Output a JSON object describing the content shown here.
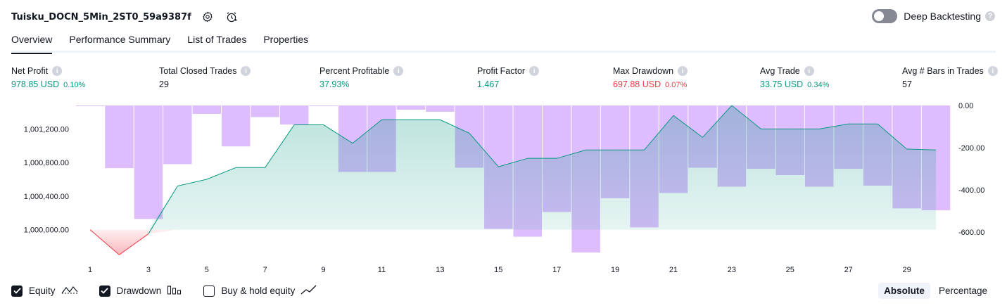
{
  "header": {
    "strategy_name": "Tuisku_DOCN_5Min_2ST0_59a9387f",
    "settings_icon": "gear-icon",
    "alert_icon": "alarm-clock-icon",
    "deep_backtesting_label": "Deep Backtesting",
    "deep_backtesting_enabled": false,
    "help_mark": "?"
  },
  "tabs": [
    {
      "label": "Overview",
      "active": true
    },
    {
      "label": "Performance Summary",
      "active": false
    },
    {
      "label": "List of Trades",
      "active": false
    },
    {
      "label": "Properties",
      "active": false
    }
  ],
  "metrics": [
    {
      "label": "Net Profit",
      "value": "978.85 USD",
      "pct": "0.10%",
      "color": "#089981"
    },
    {
      "label": "Total Closed Trades",
      "value": "29",
      "pct": "",
      "color": "#131722"
    },
    {
      "label": "Percent Profitable",
      "value": "37.93%",
      "pct": "",
      "color": "#089981"
    },
    {
      "label": "Profit Factor",
      "value": "1.467",
      "pct": "",
      "color": "#089981"
    },
    {
      "label": "Max Drawdown",
      "value": "697.88 USD",
      "pct": "0.07%",
      "color": "#f23645"
    },
    {
      "label": "Avg Trade",
      "value": "33.75 USD",
      "pct": "0.34%",
      "color": "#089981"
    },
    {
      "label": "Avg # Bars in Trades",
      "value": "57",
      "pct": "",
      "color": "#131722"
    }
  ],
  "info_mark": "i",
  "chart_data": {
    "type": "area",
    "x_ticks": [
      "1",
      "3",
      "5",
      "7",
      "9",
      "11",
      "13",
      "15",
      "17",
      "19",
      "21",
      "23",
      "25",
      "27",
      "29"
    ],
    "left_axis": {
      "ticks": [
        "1,001,200.00",
        "1,000,800.00",
        "1,000,400.00",
        "1,000,000.00"
      ],
      "ylim": [
        999720,
        1001480
      ]
    },
    "right_axis": {
      "ticks": [
        "0.00",
        "-200.00",
        "-400.00",
        "-600.00"
      ],
      "ylim": [
        -700,
        0
      ]
    },
    "series": [
      {
        "name": "Equity",
        "color": "#089981",
        "x": [
          1,
          2,
          3,
          4,
          5,
          6,
          7,
          8,
          9,
          10,
          11,
          12,
          13,
          14,
          15,
          16,
          17,
          18,
          19,
          20,
          21,
          22,
          23,
          24,
          25,
          26,
          27,
          28,
          29,
          30
        ],
        "values": [
          1000000,
          999700,
          999950,
          1000520,
          1000600,
          1000740,
          1000740,
          1001250,
          1001250,
          1001030,
          1001310,
          1001310,
          1001310,
          1001150,
          1000750,
          1000850,
          1000850,
          1000950,
          1000950,
          1000950,
          1001360,
          1001100,
          1001480,
          1001200,
          1001200,
          1001200,
          1001260,
          1001260,
          1000960,
          1000950
        ]
      },
      {
        "name": "Drawdown",
        "color": "#d7b1fd",
        "x": [
          1,
          2,
          3,
          4,
          5,
          6,
          7,
          8,
          9,
          10,
          11,
          12,
          13,
          14,
          15,
          16,
          17,
          18,
          19,
          20,
          21,
          22,
          23,
          24,
          25,
          26,
          27,
          28,
          29,
          30
        ],
        "values": [
          -3,
          -297,
          -538,
          -278,
          -40,
          -194,
          -55,
          -90,
          -3,
          -315,
          -315,
          -20,
          -30,
          -295,
          -585,
          -622,
          -505,
          -697,
          -440,
          -578,
          -415,
          -295,
          -385,
          -300,
          -330,
          -385,
          -300,
          -380,
          -488,
          -497
        ]
      }
    ],
    "grid": false
  },
  "legend": [
    {
      "label": "Equity",
      "checked": true,
      "icon": "equity-line-icon"
    },
    {
      "label": "Drawdown",
      "checked": true,
      "icon": "drawdown-bars-icon"
    },
    {
      "label": "Buy & hold equity",
      "checked": false,
      "icon": "buy-hold-line-icon"
    }
  ],
  "modes": [
    {
      "label": "Absolute",
      "active": true
    },
    {
      "label": "Percentage",
      "active": false
    }
  ]
}
